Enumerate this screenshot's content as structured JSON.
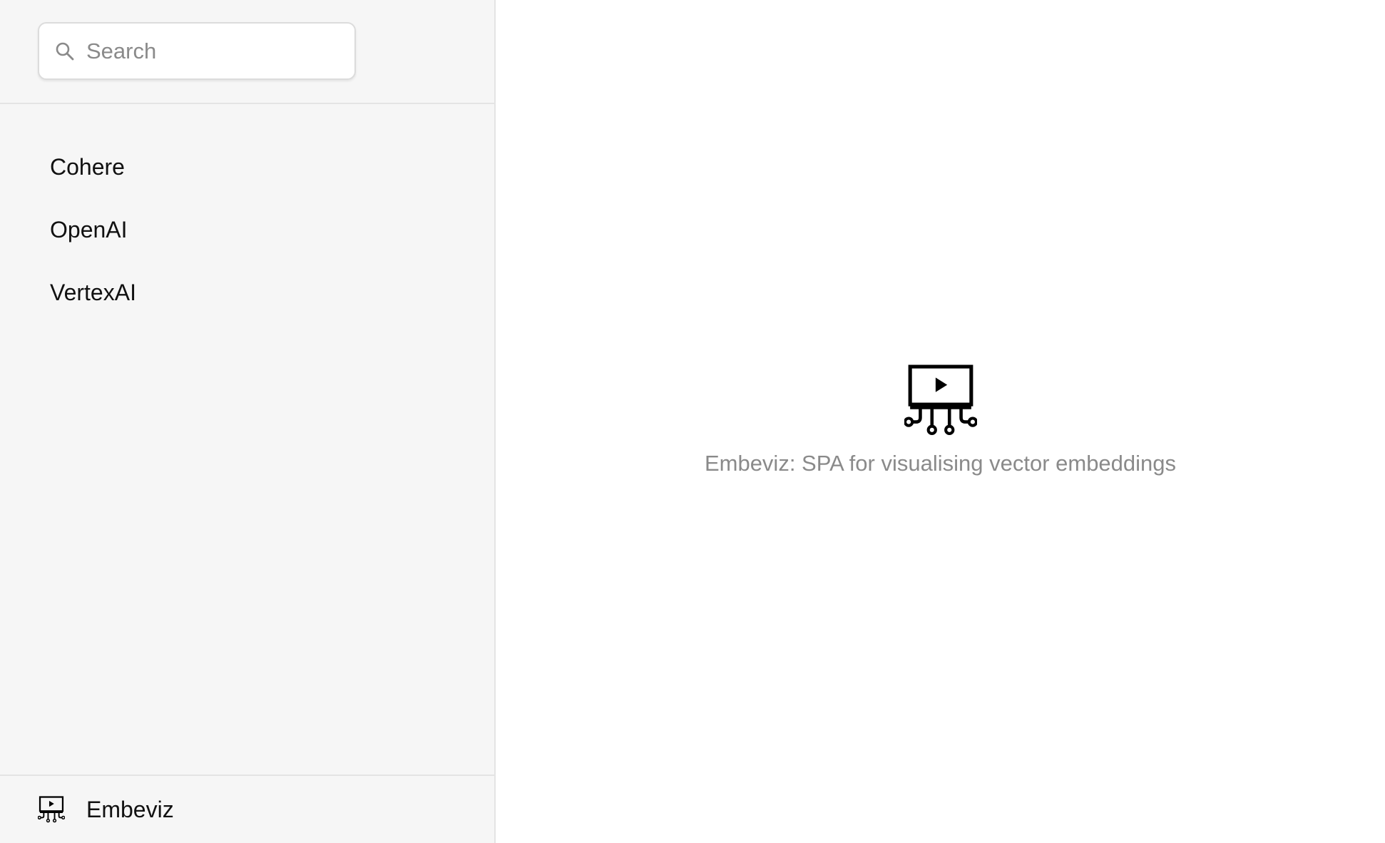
{
  "search": {
    "placeholder": "Search",
    "value": ""
  },
  "sidebar": {
    "items": [
      {
        "label": "Cohere"
      },
      {
        "label": "OpenAI"
      },
      {
        "label": "VertexAI"
      }
    ]
  },
  "footer": {
    "title": "Embeviz",
    "icon": "embeviz-logo-icon"
  },
  "main": {
    "icon": "embeviz-logo-icon",
    "tagline": "Embeviz: SPA for visualising vector embeddings"
  },
  "colors": {
    "sidebar_bg": "#f6f6f6",
    "border": "#e4e4e4",
    "tagline": "#8a8a8a",
    "text": "#111111"
  }
}
